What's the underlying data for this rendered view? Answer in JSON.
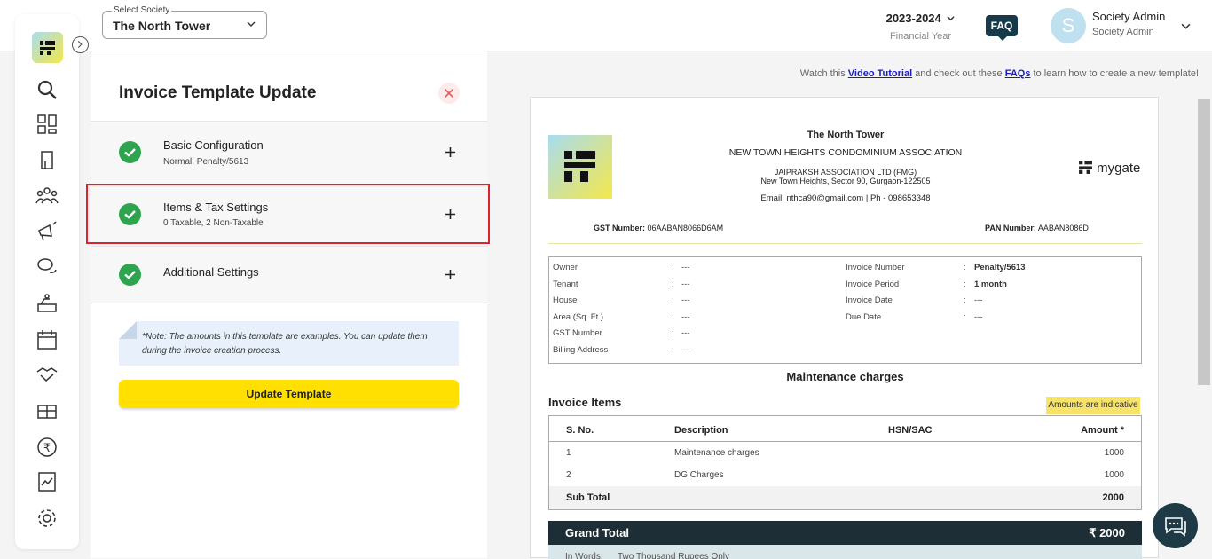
{
  "header": {
    "select_label": "Select Society",
    "society": "The North Tower",
    "financial_year": "2023-2024",
    "financial_year_label": "Financial Year",
    "faq": "FAQ",
    "avatar_initial": "S",
    "user_name": "Society Admin",
    "user_role": "Society Admin"
  },
  "sidebar": {
    "icons": [
      "search-icon",
      "dashboard-icon",
      "building-icon",
      "residents-icon",
      "announcement-icon",
      "chat-icon",
      "services-icon",
      "calendar-icon",
      "handshake-icon",
      "parcel-icon",
      "rupee-icon",
      "reports-icon",
      "settings-icon"
    ]
  },
  "panel": {
    "title": "Invoice Template Update",
    "sections": [
      {
        "title": "Basic Configuration",
        "subtitle": "Normal, Penalty/5613"
      },
      {
        "title": "Items & Tax Settings",
        "subtitle": "0 Taxable, 2 Non-Taxable"
      },
      {
        "title": "Additional Settings",
        "subtitle": ""
      }
    ],
    "note": "*Note: The amounts in this template are examples. You can update them during the invoice creation process.",
    "update_button": "Update Template"
  },
  "preview": {
    "tutorial_prefix": "Watch this ",
    "tutorial_link": "Video Tutorial",
    "tutorial_mid": " and check out these ",
    "faq_link": "FAQs",
    "tutorial_suffix": " to learn how to create a new template!",
    "society_name": "The North Tower",
    "association": "NEW TOWN HEIGHTS CONDOMINIUM ASSOCIATION",
    "builder": "JAIPRAKSH ASSOCIATION LTD (FMG)",
    "address": "New Town Heights, Sector 90, Gurgaon-122505",
    "contact": "Email: nthca90@gmail.com | Ph - 098653348",
    "brand": "mygate",
    "gst_label": "GST Number:",
    "gst_value": "06AABAN8066D6AM",
    "pan_label": "PAN Number:",
    "pan_value": "AABAN8086D",
    "info_left": [
      {
        "label": "Owner",
        "value": "---"
      },
      {
        "label": "Tenant",
        "value": "---"
      },
      {
        "label": "House",
        "value": "---"
      },
      {
        "label": "Area (Sq. Ft.)",
        "value": "---"
      },
      {
        "label": "GST Number",
        "value": "---"
      },
      {
        "label": "Billing Address",
        "value": "---"
      }
    ],
    "info_right": [
      {
        "label": "Invoice Number",
        "value": "Penalty/5613"
      },
      {
        "label": "Invoice Period",
        "value": "1 month"
      },
      {
        "label": "Invoice Date",
        "value": "---"
      },
      {
        "label": "Due Date",
        "value": "---"
      }
    ],
    "section_title": "Maintenance charges",
    "items_title": "Invoice Items",
    "indicative": "Amounts are indicative",
    "columns": [
      "S. No.",
      "Description",
      "HSN/SAC",
      "Amount *"
    ],
    "rows": [
      {
        "sno": "1",
        "desc": "Maintenance charges",
        "hsn": "",
        "amount": "1000"
      },
      {
        "sno": "2",
        "desc": "DG Charges",
        "hsn": "",
        "amount": "1000"
      }
    ],
    "subtotal_label": "Sub Total",
    "subtotal_value": "2000",
    "grand_label": "Grand Total",
    "grand_value": "₹ 2000",
    "words_label": "In Words:",
    "words_value": "Two Thousand Rupees Only"
  }
}
